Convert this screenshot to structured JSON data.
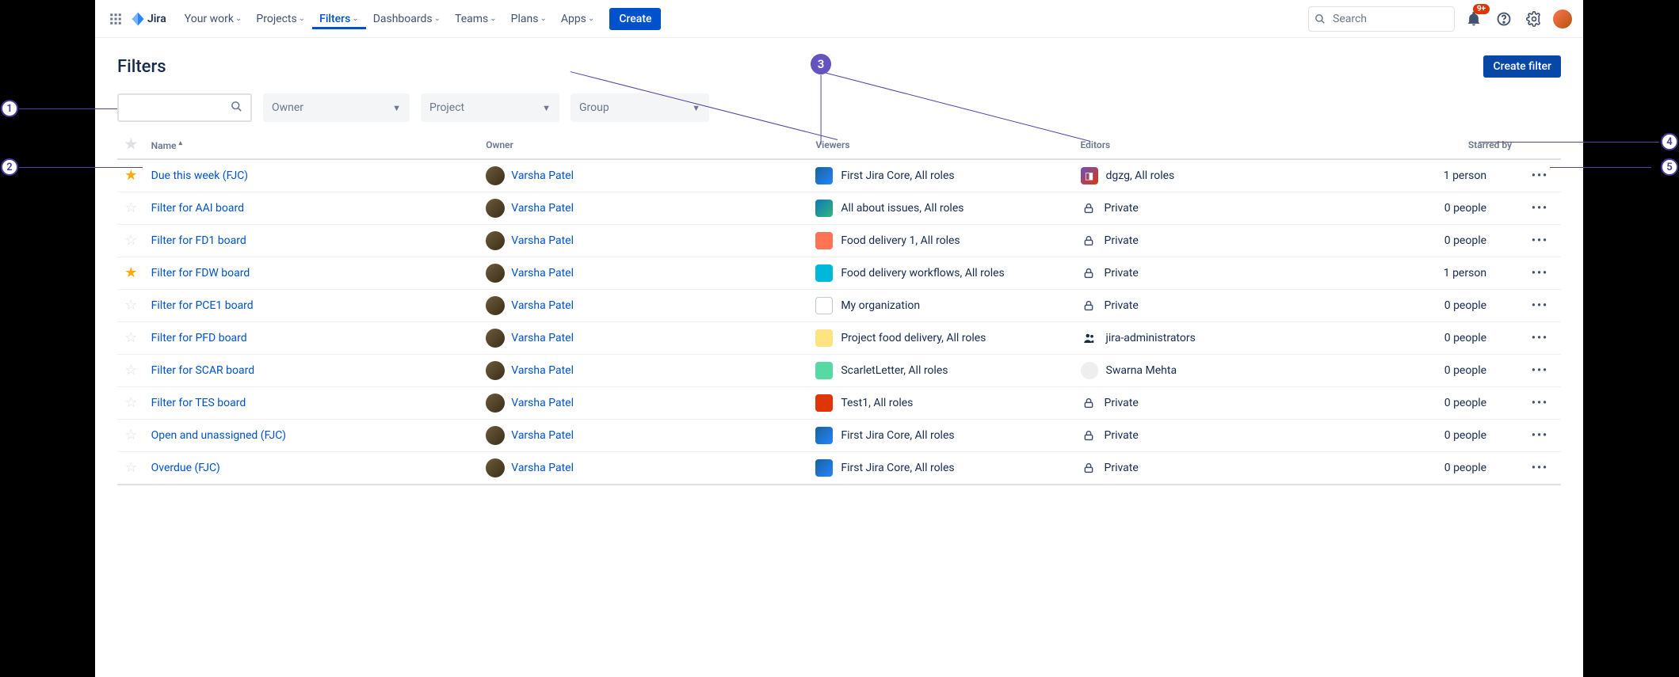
{
  "nav": {
    "logo_text": "Jira",
    "items": [
      "Your work",
      "Projects",
      "Filters",
      "Dashboards",
      "Teams",
      "Plans",
      "Apps"
    ],
    "active_index": 2,
    "create_label": "Create",
    "search_placeholder": "Search",
    "notification_badge": "9+"
  },
  "page": {
    "title": "Filters",
    "create_filter_label": "Create filter"
  },
  "controls": {
    "owner": "Owner",
    "project": "Project",
    "group": "Group"
  },
  "columns": {
    "name": "Name",
    "owner": "Owner",
    "viewers": "Viewers",
    "editors": "Editors",
    "starred_by": "Starred by"
  },
  "rows": [
    {
      "starred": true,
      "name": "Due this week (FJC)",
      "owner": "Varsha Patel",
      "viewers_icon": "rocket",
      "viewers": "First Jira Core, All roles",
      "editors_icon": "dgzg",
      "editors": "dgzg, All roles",
      "starred_by": "1 person"
    },
    {
      "starred": false,
      "name": "Filter for AAI board",
      "owner": "Varsha Patel",
      "viewers_icon": "iss",
      "viewers": "All about issues, All roles",
      "editors_icon": "lock",
      "editors": "Private",
      "starred_by": "0 people"
    },
    {
      "starred": false,
      "name": "Filter for FD1 board",
      "owner": "Varsha Patel",
      "viewers_icon": "food",
      "viewers": "Food delivery 1, All roles",
      "editors_icon": "lock",
      "editors": "Private",
      "starred_by": "0 people"
    },
    {
      "starred": true,
      "name": "Filter for FDW board",
      "owner": "Varsha Patel",
      "viewers_icon": "wf",
      "viewers": "Food delivery workflows, All roles",
      "editors_icon": "lock",
      "editors": "Private",
      "starred_by": "1 person"
    },
    {
      "starred": false,
      "name": "Filter for PCE1 board",
      "owner": "Varsha Patel",
      "viewers_icon": "org",
      "viewers": "My organization",
      "editors_icon": "lock",
      "editors": "Private",
      "starred_by": "0 people"
    },
    {
      "starred": false,
      "name": "Filter for PFD board",
      "owner": "Varsha Patel",
      "viewers_icon": "pfd",
      "viewers": "Project food delivery, All roles",
      "editors_icon": "admins",
      "editors": "jira-administrators",
      "starred_by": "0 people"
    },
    {
      "starred": false,
      "name": "Filter for SCAR board",
      "owner": "Varsha Patel",
      "viewers_icon": "scarlet",
      "viewers": "ScarletLetter, All roles",
      "editors_icon": "avatar",
      "editors": "Swarna Mehta",
      "starred_by": "0 people"
    },
    {
      "starred": false,
      "name": "Filter for TES board",
      "owner": "Varsha Patel",
      "viewers_icon": "test",
      "viewers": "Test1, All roles",
      "editors_icon": "lock",
      "editors": "Private",
      "starred_by": "0 people"
    },
    {
      "starred": false,
      "name": "Open and unassigned (FJC)",
      "owner": "Varsha Patel",
      "viewers_icon": "rocket",
      "viewers": "First Jira Core, All roles",
      "editors_icon": "lock",
      "editors": "Private",
      "starred_by": "0 people"
    },
    {
      "starred": false,
      "name": "Overdue (FJC)",
      "owner": "Varsha Patel",
      "viewers_icon": "rocket",
      "viewers": "First Jira Core, All roles",
      "editors_icon": "lock",
      "editors": "Private",
      "starred_by": "0 people"
    }
  ],
  "annotations": [
    "1",
    "2",
    "3",
    "4",
    "5"
  ]
}
